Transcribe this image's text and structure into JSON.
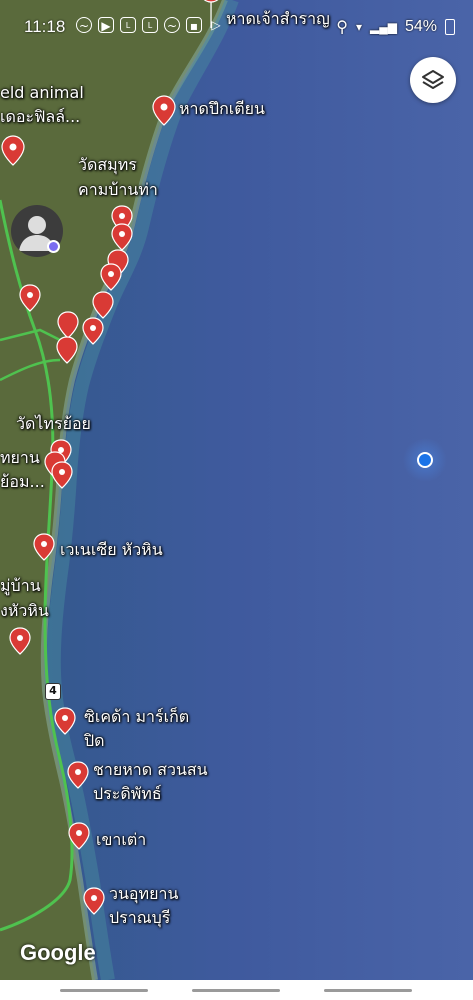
{
  "status_bar": {
    "time": "11:18",
    "battery": "54%",
    "left_icons": [
      "messenger-icon",
      "youtube-icon",
      "line-icon",
      "line-icon",
      "messenger-icon",
      "gallery-icon",
      "play-icon"
    ],
    "right_icons": [
      "location-icon",
      "wifi-icon",
      "signal-icon",
      "battery-icon"
    ]
  },
  "map": {
    "places": [
      {
        "name": "หาดเจ้าสำราญ",
        "icon": "beach"
      },
      {
        "name": "หาดปึกเตียน",
        "icon": "beach"
      },
      {
        "name": "วัดสมุทร\nคามบ้านท่า",
        "icon": "none"
      },
      {
        "name": "วัดไทรย้อย",
        "icon": "none"
      },
      {
        "name": "เวเนเซีย หัวหิน",
        "icon": "camera"
      },
      {
        "name": "ซิเคด้า มาร์เก็ต\nปิด",
        "icon": "camera"
      },
      {
        "name": "ชายหาด สวนสน\nประดิพัทธ์",
        "icon": "beach"
      },
      {
        "name": "เขาเต่า",
        "icon": "pin"
      },
      {
        "name": "วนอุทยาน\nปราณบุรี",
        "icon": "tree"
      }
    ],
    "partial_labels": [
      "eld animal",
      "เดอะฟิลล์...",
      "ทยาน",
      "ย้อม...",
      "มู่บ้าน",
      "งหัวหิน"
    ],
    "road_number": "4",
    "colors": {
      "sea": "#3e5aa0",
      "land": "#5d6b3a",
      "road": "#4fc24f",
      "pin": "#d93a35"
    }
  },
  "controls": {
    "layers": "layers-icon",
    "avatar": "profile-avatar"
  },
  "footer": {
    "brand": "Google"
  }
}
